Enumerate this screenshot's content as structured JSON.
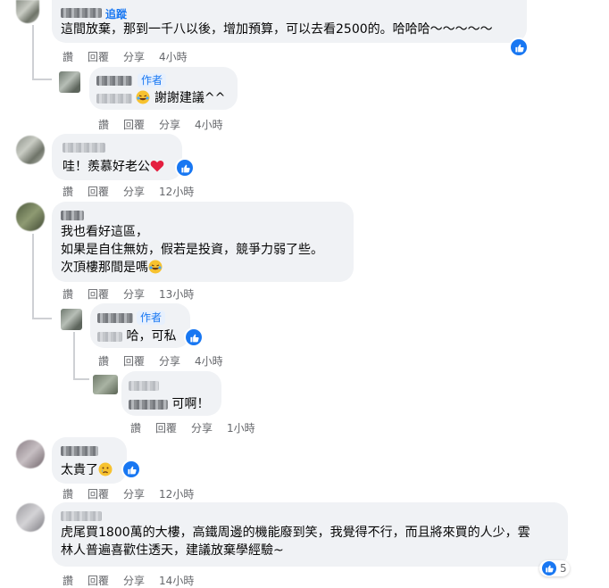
{
  "comments": [
    {
      "text": "這間放棄，那到一千八以後，增加預算，可以去看2500的。哈哈哈～～～～～",
      "follow_label": "追蹤",
      "actions": [
        "讚",
        "回覆",
        "分享"
      ],
      "time": "4小時"
    },
    {
      "badge": "作者",
      "text": "謝謝建議^^",
      "actions": [
        "讚",
        "回覆",
        "分享"
      ],
      "time": "4小時"
    },
    {
      "text": "哇！羨慕好老公",
      "actions": [
        "讚",
        "回覆",
        "分享"
      ],
      "time": "12小時"
    },
    {
      "lines": [
        "我也看好這區，",
        "如果是自住無妨，假若是投資，競爭力弱了些。",
        "次頂樓那間是嗎"
      ],
      "actions": [
        "讚",
        "回覆",
        "分享"
      ],
      "time": "13小時"
    },
    {
      "badge": "作者",
      "text": "哈，可私",
      "actions": [
        "讚",
        "回覆",
        "分享"
      ],
      "time": "4小時"
    },
    {
      "text": "可啊！",
      "actions": [
        "讚",
        "回覆",
        "分享"
      ],
      "time": "1小時"
    },
    {
      "text": "太貴了",
      "actions": [
        "讚",
        "回覆",
        "分享"
      ],
      "time": "12小時"
    },
    {
      "lines": [
        "虎尾買1800萬的大樓，高鐵周邊的機能廢到笑，我覺得不行，而且將來買的人少，雲",
        "林人普遍喜歡住透天，建議放棄學經驗~"
      ],
      "reaction_count": "5",
      "actions": [
        "讚",
        "回覆",
        "分享"
      ],
      "time": "14小時"
    }
  ],
  "colors": {
    "accent": "#1877f2",
    "bubble": "#f0f2f5",
    "meta": "#65676b",
    "heart": "#e41e3f"
  }
}
